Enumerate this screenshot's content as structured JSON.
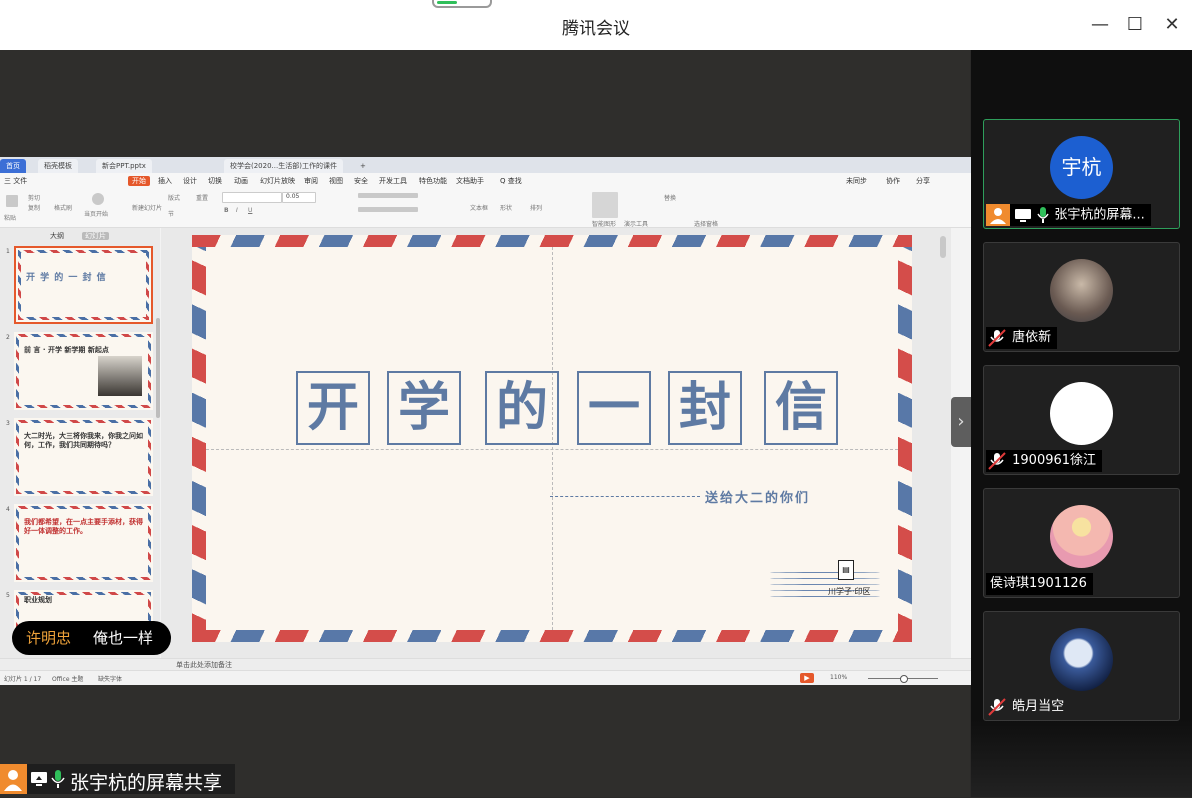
{
  "app": {
    "title": "腾讯会议",
    "window_controls": [
      "minimize-icon",
      "maximize-icon",
      "close-icon"
    ]
  },
  "wps": {
    "tabs": [
      {
        "label": "首页"
      },
      {
        "label": "稻壳模板"
      },
      {
        "label": "新会PPT.pptx"
      },
      {
        "label": "校学会(2020...生活部)工作的课件"
      }
    ],
    "menus": [
      "三 文件",
      "开始",
      "插入",
      "设计",
      "切换",
      "动画",
      "幻灯片放映",
      "审阅",
      "视图",
      "安全",
      "开发工具",
      "特色功能",
      "文档助手",
      "Q 查找"
    ],
    "active_menu_index": 1,
    "right_menu": [
      "未同步",
      "协作",
      "分享"
    ],
    "ribbon_labels": [
      "粘贴",
      "剪切",
      "复制",
      "格式刷",
      "当页开始",
      "新建幻灯片",
      "版式",
      "重置",
      "节",
      "B",
      "I",
      "U",
      "文本框",
      "形状",
      "排列",
      "智能图形",
      "演示工具",
      "替换",
      "选择窗格"
    ],
    "font_size": "0.05",
    "pane_tabs": [
      "大纲",
      "幻灯片"
    ],
    "thumbnails": [
      {
        "num": "1",
        "text": "开 学 的 一 封 信",
        "red": false
      },
      {
        "num": "2",
        "text": "前 言  ·  开学 新学期 新起点",
        "red": false
      },
      {
        "num": "3",
        "text": "大二时光，大三将你我来，你我之问如何，工作，我们共同期待吗？",
        "red": false
      },
      {
        "num": "4",
        "text": "我们都希望，在一点主要手添材，获得好一体调整的工作。",
        "red": true
      },
      {
        "num": "5",
        "text": "职业规划",
        "red": false
      }
    ],
    "slide": {
      "title_chars": [
        "开",
        "学",
        "的",
        "一",
        "封",
        "信"
      ],
      "subtitle": "送给大二的你们",
      "stamp_text": "川学子·印区"
    },
    "notes_placeholder": "单击此处添加备注",
    "status": {
      "slide_count": "幻灯片 1 / 17",
      "theme": "Office 主题",
      "font_missing": "缺失字体",
      "zoom": "110%"
    }
  },
  "danmu": {
    "name": "许明忠",
    "message": "俺也一样"
  },
  "share_bar": {
    "label": "张宇杭的屏幕共享"
  },
  "participants": [
    {
      "name": "张宇杭的屏幕...",
      "avatar_text": "宇杭",
      "avatar_color": "#1c5fd1",
      "muted": false,
      "sharing": true,
      "active": true
    },
    {
      "name": "唐依新",
      "avatar_text": "",
      "avatar_color": "#7a6a60",
      "muted": true,
      "sharing": false,
      "active": false
    },
    {
      "name": "1900961徐江",
      "avatar_text": "",
      "avatar_color": "#ffffff",
      "muted": true,
      "sharing": false,
      "active": false
    },
    {
      "name": "侯诗琪1901126",
      "avatar_text": "",
      "avatar_color": "#f2c7c0",
      "muted": false,
      "sharing": false,
      "active": false
    },
    {
      "name": "皓月当空",
      "avatar_text": "",
      "avatar_color": "#1d3a6e",
      "muted": true,
      "sharing": false,
      "active": false
    }
  ],
  "colors": {
    "accent_orange": "#e5582b",
    "slide_blue": "#5e7aa3",
    "stripe_red": "#d44d4a",
    "active_border": "#2e9e5b"
  }
}
